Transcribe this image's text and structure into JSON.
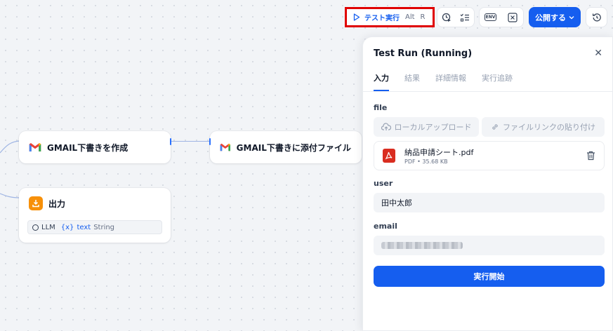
{
  "canvas": {
    "nodes": {
      "gmail_create": {
        "title": "GMAIL下書きを作成"
      },
      "gmail_attach": {
        "title": "GMAIL下書きに添付ファイルを..."
      },
      "output": {
        "title": "出力",
        "var_source": "LLM",
        "var_marker": "{x}",
        "var_name": "text",
        "var_type": "String"
      }
    }
  },
  "toolbar": {
    "test_run_label": "テスト実行",
    "shortcut_alt": "Alt",
    "shortcut_key": "R",
    "env_label": "ENV",
    "publish_label": "公開する",
    "highlight_color": "#e00000",
    "accent": "#155eef"
  },
  "panel": {
    "title": "Test Run (Running)",
    "tabs": [
      "入力",
      "結果",
      "詳細情報",
      "実行追跡"
    ],
    "file_label": "file",
    "local_upload": "ローカルアップロード",
    "paste_link": "ファイルリンクの貼り付け",
    "file": {
      "name": "納品申請シート.pdf",
      "type": "PDF",
      "size": "35.68 KB",
      "sep": "•"
    },
    "user_label": "user",
    "user_value": "田中太郎",
    "email_label": "email",
    "run_button": "実行開始"
  }
}
